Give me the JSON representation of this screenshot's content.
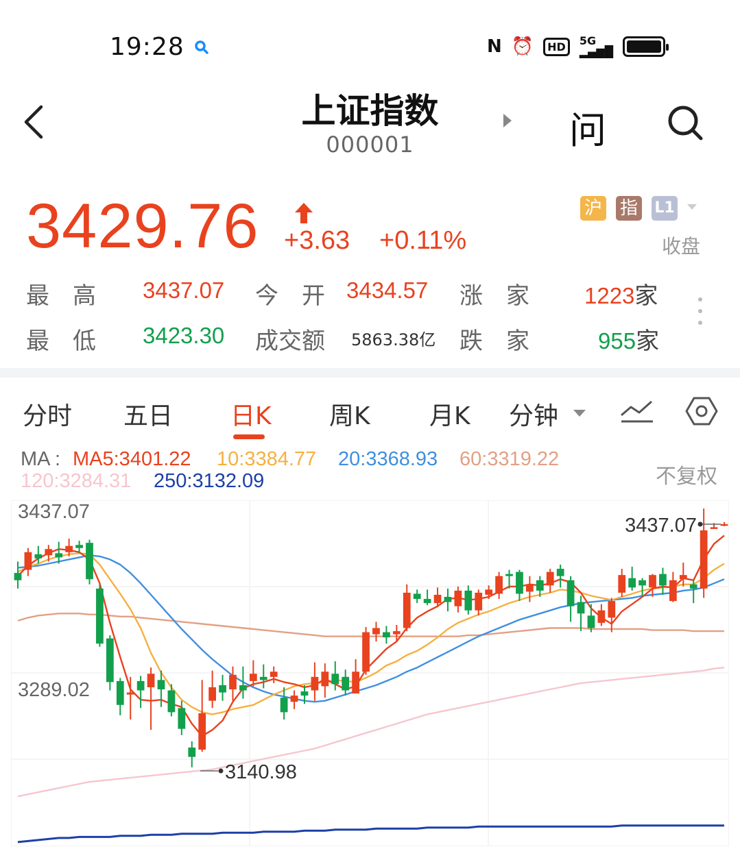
{
  "status": {
    "time": "19:28",
    "network": "5G"
  },
  "header": {
    "title": "上证指数",
    "code": "000001",
    "ask_label": "问"
  },
  "quote": {
    "price": "3429.76",
    "change": "+3.63",
    "change_pct": "+0.11%",
    "badges": [
      "沪",
      "指",
      "L1"
    ],
    "market_status": "收盘",
    "colors": {
      "up": "#e8421f",
      "down": "#12a04c"
    }
  },
  "stats": {
    "high_label": "最　高",
    "high": "3437.07",
    "open_label": "今　开",
    "open": "3434.57",
    "adv_label": "涨　家",
    "adv": "1223",
    "adv_unit": "家",
    "low_label": "最　低",
    "low": "3423.30",
    "turnover_label": "成交额",
    "turnover": "5863.38亿",
    "dec_label": "跌　家",
    "dec": "955",
    "dec_unit": "家"
  },
  "tabs": [
    "分时",
    "五日",
    "日K",
    "周K",
    "月K",
    "分钟"
  ],
  "ma": {
    "prefix": "MA :",
    "ma5": "MA5:3401.22",
    "ma10": "10:3384.77",
    "ma20": "20:3368.93",
    "ma60": "60:3319.22",
    "ma120": "120:3284.31",
    "ma250": "250:3132.09",
    "adjust": "不复权",
    "colors": {
      "ma5": "#e8421f",
      "ma10": "#f5b041",
      "ma20": "#3f8fe0",
      "ma60": "#e2a085",
      "ma120": "#f6c6cf",
      "ma250": "#1d3fa8"
    }
  },
  "chart_data": {
    "type": "candlestick",
    "y_axis_labels": [
      "3437.07",
      "3289.02"
    ],
    "high_marker": "3437.07",
    "low_marker": "3140.98",
    "ylim": [
      3112,
      3445
    ],
    "candles": [
      [
        3375,
        3368,
        3386,
        3360
      ],
      [
        3378,
        3395,
        3399,
        3372
      ],
      [
        3393,
        3389,
        3401,
        3384
      ],
      [
        3392,
        3398,
        3402,
        3386
      ],
      [
        3394,
        3390,
        3405,
        3384
      ],
      [
        3395,
        3401,
        3408,
        3391
      ],
      [
        3402,
        3399,
        3406,
        3394
      ],
      [
        3404,
        3369,
        3407,
        3364
      ],
      [
        3360,
        3307,
        3364,
        3304
      ],
      [
        3312,
        3270,
        3315,
        3262
      ],
      [
        3271,
        3248,
        3274,
        3238
      ],
      [
        3258,
        3260,
        3275,
        3234
      ],
      [
        3271,
        3262,
        3276,
        3245
      ],
      [
        3265,
        3278,
        3284,
        3224
      ],
      [
        3272,
        3263,
        3281,
        3246
      ],
      [
        3262,
        3241,
        3268,
        3237
      ],
      [
        3245,
        3225,
        3252,
        3219
      ],
      [
        3207,
        3198,
        3213,
        3188
      ],
      [
        3205,
        3240,
        3272,
        3203
      ],
      [
        3252,
        3265,
        3281,
        3245
      ],
      [
        3267,
        3260,
        3277,
        3252
      ],
      [
        3263,
        3277,
        3285,
        3252
      ],
      [
        3267,
        3262,
        3285,
        3254
      ],
      [
        3271,
        3278,
        3291,
        3266
      ],
      [
        3275,
        3272,
        3287,
        3264
      ],
      [
        3275,
        3280,
        3285,
        3269
      ],
      [
        3255,
        3241,
        3265,
        3234
      ],
      [
        3251,
        3257,
        3262,
        3244
      ],
      [
        3261,
        3257,
        3267,
        3249
      ],
      [
        3262,
        3275,
        3289,
        3252
      ],
      [
        3266,
        3280,
        3288,
        3255
      ],
      [
        3278,
        3268,
        3290,
        3262
      ],
      [
        3275,
        3262,
        3282,
        3257
      ],
      [
        3259,
        3280,
        3292,
        3259
      ],
      [
        3280,
        3318,
        3323,
        3277
      ],
      [
        3316,
        3322,
        3328,
        3309
      ],
      [
        3318,
        3313,
        3324,
        3307
      ],
      [
        3316,
        3319,
        3325,
        3309
      ],
      [
        3322,
        3356,
        3364,
        3319
      ],
      [
        3355,
        3350,
        3359,
        3346
      ],
      [
        3350,
        3346,
        3359,
        3344
      ],
      [
        3346,
        3354,
        3361,
        3342
      ],
      [
        3352,
        3347,
        3360,
        3338
      ],
      [
        3343,
        3358,
        3362,
        3337
      ],
      [
        3358,
        3339,
        3363,
        3335
      ],
      [
        3339,
        3356,
        3359,
        3334
      ],
      [
        3354,
        3359,
        3363,
        3350
      ],
      [
        3355,
        3372,
        3376,
        3350
      ],
      [
        3374,
        3372,
        3378,
        3360
      ],
      [
        3376,
        3355,
        3378,
        3348
      ],
      [
        3357,
        3364,
        3372,
        3347
      ],
      [
        3368,
        3358,
        3372,
        3352
      ],
      [
        3363,
        3376,
        3379,
        3356
      ],
      [
        3379,
        3372,
        3383,
        3361
      ],
      [
        3368,
        3343,
        3372,
        3328
      ],
      [
        3347,
        3336,
        3353,
        3319
      ],
      [
        3334,
        3322,
        3345,
        3318
      ],
      [
        3327,
        3339,
        3345,
        3324
      ],
      [
        3332,
        3348,
        3351,
        3318
      ],
      [
        3356,
        3373,
        3379,
        3352
      ],
      [
        3370,
        3361,
        3381,
        3358
      ],
      [
        3368,
        3363,
        3370,
        3353
      ],
      [
        3361,
        3373,
        3374,
        3352
      ],
      [
        3374,
        3363,
        3380,
        3354
      ],
      [
        3348,
        3368,
        3376,
        3347
      ],
      [
        3369,
        3373,
        3385,
        3362
      ],
      [
        3364,
        3360,
        3369,
        3346
      ],
      [
        3360,
        3416,
        3437,
        3351
      ],
      [
        3418,
        3419,
        3423,
        3418
      ],
      [
        3421,
        3422,
        3424,
        3420
      ]
    ],
    "ma5": [
      3372,
      3382,
      3389,
      3394,
      3398,
      3397,
      3395,
      3388,
      3365,
      3327,
      3294,
      3263,
      3253,
      3252,
      3253,
      3249,
      3246,
      3230,
      3218,
      3224,
      3233,
      3251,
      3264,
      3268,
      3270,
      3273,
      3270,
      3268,
      3265,
      3267,
      3273,
      3268,
      3263,
      3266,
      3282,
      3292,
      3302,
      3309,
      3322,
      3332,
      3338,
      3343,
      3350,
      3351,
      3349,
      3350,
      3352,
      3357,
      3362,
      3362,
      3364,
      3363,
      3365,
      3369,
      3366,
      3356,
      3341,
      3332,
      3326,
      3338,
      3345,
      3352,
      3360,
      3362,
      3361,
      3370,
      3368,
      3388,
      3403,
      3411
    ],
    "ma10": [
      3376,
      3381,
      3384,
      3388,
      3391,
      3393,
      3394,
      3393,
      3383,
      3369,
      3355,
      3340,
      3322,
      3298,
      3279,
      3265,
      3253,
      3246,
      3241,
      3239,
      3241,
      3244,
      3246,
      3248,
      3253,
      3258,
      3262,
      3266,
      3268,
      3269,
      3270,
      3272,
      3271,
      3270,
      3274,
      3279,
      3286,
      3290,
      3296,
      3300,
      3306,
      3313,
      3321,
      3327,
      3331,
      3335,
      3338,
      3342,
      3346,
      3349,
      3352,
      3354,
      3356,
      3359,
      3358,
      3356,
      3353,
      3351,
      3349,
      3352,
      3355,
      3358,
      3360,
      3361,
      3362,
      3364,
      3364,
      3370,
      3378,
      3384
    ],
    "ma20": [
      3380,
      3381,
      3382,
      3384,
      3386,
      3388,
      3390,
      3392,
      3391,
      3388,
      3383,
      3375,
      3365,
      3354,
      3343,
      3332,
      3321,
      3311,
      3301,
      3292,
      3284,
      3276,
      3270,
      3265,
      3261,
      3258,
      3256,
      3254,
      3252,
      3251,
      3252,
      3255,
      3258,
      3261,
      3264,
      3267,
      3271,
      3275,
      3280,
      3284,
      3289,
      3294,
      3299,
      3304,
      3309,
      3314,
      3318,
      3322,
      3326,
      3330,
      3333,
      3336,
      3339,
      3342,
      3344,
      3346,
      3347,
      3348,
      3349,
      3350,
      3351,
      3353,
      3354,
      3355,
      3356,
      3358,
      3359,
      3361,
      3365,
      3369
    ],
    "ma60": [
      3329,
      3332,
      3334,
      3335,
      3336,
      3336,
      3336,
      3335,
      3335,
      3334,
      3333,
      3333,
      3332,
      3331,
      3330,
      3329,
      3328,
      3327,
      3326,
      3325,
      3324,
      3323,
      3322,
      3321,
      3320,
      3319,
      3318,
      3317,
      3316,
      3315,
      3314,
      3314,
      3314,
      3314,
      3314,
      3314,
      3314,
      3314,
      3314,
      3314,
      3314,
      3314,
      3314,
      3314,
      3315,
      3315,
      3316,
      3317,
      3318,
      3319,
      3320,
      3321,
      3322,
      3322,
      3322,
      3322,
      3321,
      3321,
      3321,
      3321,
      3321,
      3321,
      3320,
      3320,
      3320,
      3320,
      3319,
      3319,
      3319,
      3319
    ],
    "ma120": [
      3160,
      3162,
      3164,
      3166,
      3168,
      3170,
      3172,
      3174,
      3175,
      3176,
      3177,
      3178,
      3179,
      3180,
      3181,
      3182,
      3183,
      3184,
      3185,
      3186,
      3188,
      3190,
      3192,
      3194,
      3196,
      3198,
      3200,
      3202,
      3204,
      3206,
      3209,
      3212,
      3215,
      3218,
      3221,
      3224,
      3227,
      3230,
      3233,
      3236,
      3239,
      3241,
      3243,
      3245,
      3247,
      3249,
      3251,
      3253,
      3255,
      3257,
      3259,
      3261,
      3263,
      3265,
      3267,
      3269,
      3270,
      3271,
      3272,
      3273,
      3274,
      3275,
      3276,
      3277,
      3278,
      3279,
      3280,
      3281,
      3283,
      3284
    ],
    "ma250": [
      3116,
      3117,
      3118,
      3119,
      3120,
      3120,
      3121,
      3121,
      3121,
      3121,
      3122,
      3122,
      3122,
      3123,
      3123,
      3123,
      3124,
      3124,
      3124,
      3124,
      3125,
      3125,
      3125,
      3125,
      3126,
      3126,
      3126,
      3126,
      3127,
      3127,
      3127,
      3128,
      3128,
      3128,
      3128,
      3129,
      3129,
      3129,
      3129,
      3129,
      3130,
      3130,
      3130,
      3130,
      3130,
      3131,
      3131,
      3131,
      3131,
      3131,
      3131,
      3131,
      3131,
      3131,
      3131,
      3131,
      3131,
      3131,
      3131,
      3132,
      3132,
      3132,
      3132,
      3132,
      3132,
      3132,
      3132,
      3132,
      3132,
      3132
    ]
  }
}
